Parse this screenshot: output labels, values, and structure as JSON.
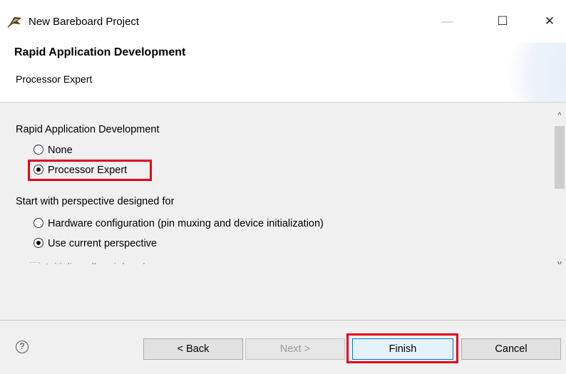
{
  "window": {
    "title": "New Bareboard Project",
    "minimize_glyph": "—",
    "maximize_glyph": "☐",
    "close_glyph": "✕"
  },
  "header": {
    "title": "Rapid Application Development",
    "subtitle": "Processor Expert"
  },
  "rad_group": {
    "label": "Rapid Application Development",
    "options": [
      {
        "label": "None",
        "selected": false
      },
      {
        "label": "Processor Expert",
        "selected": true
      }
    ]
  },
  "perspective_group": {
    "label": "Start with perspective designed for",
    "options": [
      {
        "label": "Hardware configuration (pin muxing and device initialization)",
        "selected": false
      },
      {
        "label": "Use current perspective",
        "selected": true
      }
    ]
  },
  "init_peripherals": {
    "label": "Initialize all peripherals",
    "checked": false,
    "enabled": false
  },
  "scroll": {
    "up_glyph": "^",
    "down_glyph": "v"
  },
  "footer": {
    "help_glyph": "?",
    "back_label": "< Back",
    "next_label": "Next >",
    "finish_label": "Finish",
    "cancel_label": "Cancel"
  },
  "colors": {
    "highlight": "#e3001b",
    "focus": "#0078d7"
  }
}
